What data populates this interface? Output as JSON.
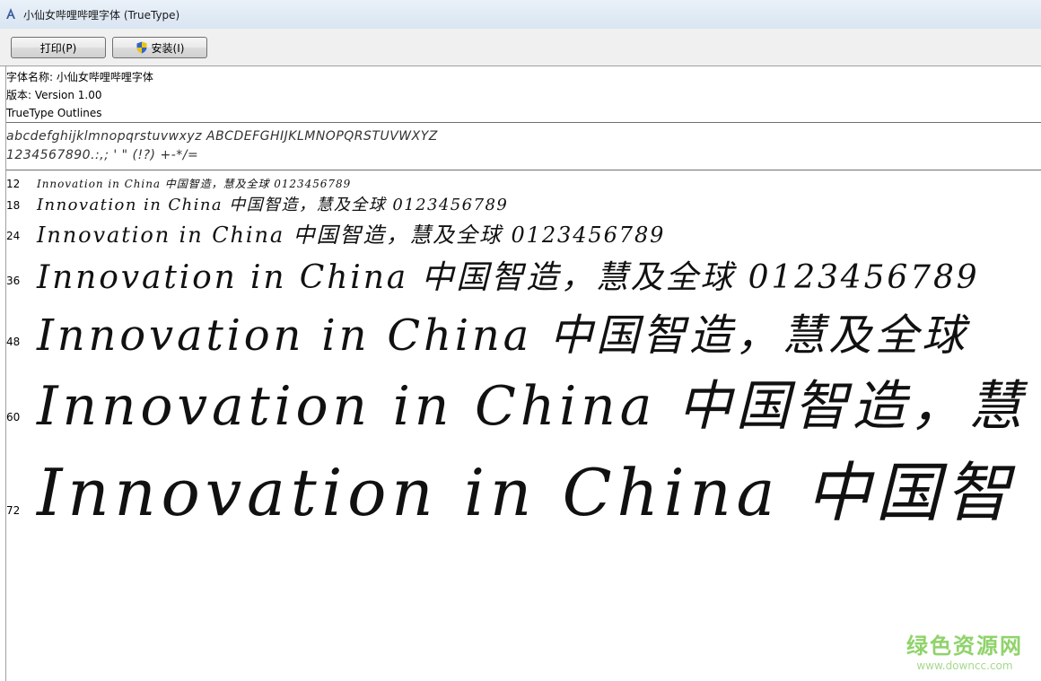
{
  "window": {
    "title": "小仙女哔哩哔哩字体 (TrueType)"
  },
  "toolbar": {
    "print_label": "打印(P)",
    "install_label": "安装(I)"
  },
  "font_info": {
    "name_line": "字体名称: 小仙女哔哩哔哩字体",
    "version_line": "版本: Version 1.00",
    "outline_line": "TrueType Outlines"
  },
  "charset": {
    "line1": "abcdefghijklmnopqrstuvwxyz ABCDEFGHIJKLMNOPQRSTUVWXYZ",
    "line2": "1234567890.:,; ' \" (!?) +-*/="
  },
  "samples": [
    {
      "size": "12",
      "text": "Innovation in China 中国智造，慧及全球 0123456789"
    },
    {
      "size": "18",
      "text": "Innovation in China 中国智造，慧及全球 0123456789"
    },
    {
      "size": "24",
      "text": "Innovation in China 中国智造，慧及全球 0123456789"
    },
    {
      "size": "36",
      "text": "Innovation in China 中国智造，慧及全球 0123456789"
    },
    {
      "size": "48",
      "text": "Innovation in China 中国智造，慧及全球"
    },
    {
      "size": "60",
      "text": "Innovation in China 中国智造，慧"
    },
    {
      "size": "72",
      "text": "Innovation in China 中国智"
    }
  ],
  "watermark": {
    "cn": "绿色资源网",
    "url": "www.downcc.com"
  }
}
